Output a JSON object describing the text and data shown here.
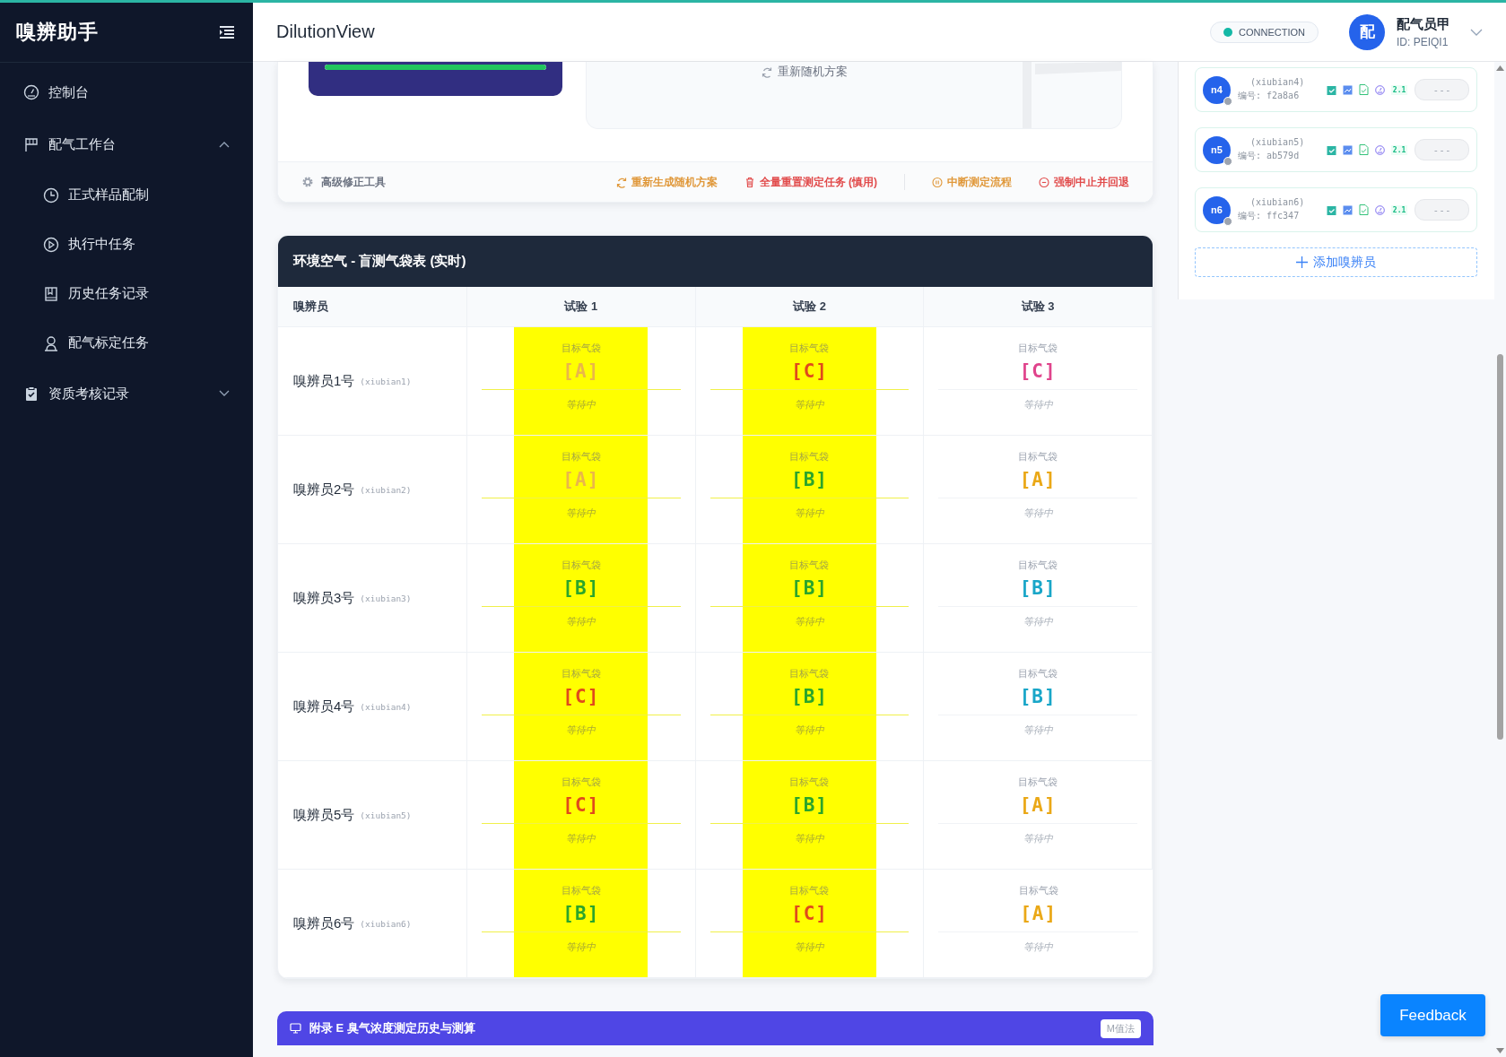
{
  "sidebar": {
    "logo": "嗅辨助手",
    "items": [
      {
        "label": "控制台"
      },
      {
        "label": "配气工作台",
        "expanded": true,
        "children": [
          {
            "label": "正式样品配制"
          },
          {
            "label": "执行中任务"
          },
          {
            "label": "历史任务记录"
          },
          {
            "label": "配气标定任务"
          }
        ]
      },
      {
        "label": "资质考核记录",
        "expanded": false
      }
    ]
  },
  "header": {
    "title": "DilutionView",
    "connection": "CONNECTION",
    "user": {
      "avatar": "配",
      "name": "配气员甲",
      "id": "ID: PEIQI1"
    }
  },
  "plan_card": {
    "progress": {
      "level": 1
    },
    "reshuffle": "重新随机方案",
    "footer": {
      "tool": "高级修正工具",
      "actions": [
        {
          "label": "重新生成随机方案",
          "color": "#e0983a"
        },
        {
          "label": "全量重置测定任务 (慎用)",
          "color": "#e14a4a"
        },
        {
          "label": "中断测定流程",
          "color": "#e0983a"
        },
        {
          "label": "强制中止并回退",
          "color": "#e14a4a"
        }
      ]
    }
  },
  "table": {
    "title": "环境空气 - 盲测气袋表 (实时)",
    "name_header": "嗅辨员",
    "columns": [
      {
        "label": "试验 1",
        "highlighted": true
      },
      {
        "label": "试验 2",
        "highlighted": true
      },
      {
        "label": "试验 3"
      }
    ],
    "rows": [
      {
        "name": "嗅辨员1号",
        "code": "(xiubian1)",
        "cells": [
          {
            "label": "目标气袋",
            "bag": "[A]",
            "color": "#eab64a",
            "status": "等待中"
          },
          {
            "label": "目标气袋",
            "bag": "[C]",
            "color": "#e04a1c",
            "status": "等待中"
          },
          {
            "label": "目标气袋",
            "bag": "[C]",
            "color": "#e0448c",
            "status": "等待中"
          }
        ]
      },
      {
        "name": "嗅辨员2号",
        "code": "(xiubian2)",
        "cells": [
          {
            "label": "目标气袋",
            "bag": "[A]",
            "color": "#eab64a",
            "status": "等待中"
          },
          {
            "label": "目标气袋",
            "bag": "[B]",
            "color": "#2ba52b",
            "status": "等待中"
          },
          {
            "label": "目标气袋",
            "bag": "[A]",
            "color": "#eaa817",
            "status": "等待中"
          }
        ]
      },
      {
        "name": "嗅辨员3号",
        "code": "(xiubian3)",
        "cells": [
          {
            "label": "目标气袋",
            "bag": "[B]",
            "color": "#2ba52b",
            "status": "等待中"
          },
          {
            "label": "目标气袋",
            "bag": "[B]",
            "color": "#2ba52b",
            "status": "等待中"
          },
          {
            "label": "目标气袋",
            "bag": "[B]",
            "color": "#19a6c8",
            "status": "等待中"
          }
        ]
      },
      {
        "name": "嗅辨员4号",
        "code": "(xiubian4)",
        "cells": [
          {
            "label": "目标气袋",
            "bag": "[C]",
            "color": "#e04a1c",
            "status": "等待中"
          },
          {
            "label": "目标气袋",
            "bag": "[B]",
            "color": "#2ba52b",
            "status": "等待中"
          },
          {
            "label": "目标气袋",
            "bag": "[B]",
            "color": "#19a6c8",
            "status": "等待中"
          }
        ]
      },
      {
        "name": "嗅辨员5号",
        "code": "(xiubian5)",
        "cells": [
          {
            "label": "目标气袋",
            "bag": "[C]",
            "color": "#e04a1c",
            "status": "等待中"
          },
          {
            "label": "目标气袋",
            "bag": "[B]",
            "color": "#2ba52b",
            "status": "等待中"
          },
          {
            "label": "目标气袋",
            "bag": "[A]",
            "color": "#eaa817",
            "status": "等待中"
          }
        ]
      },
      {
        "name": "嗅辨员6号",
        "code": "(xiubian6)",
        "cells": [
          {
            "label": "目标气袋",
            "bag": "[B]",
            "color": "#2ba52b",
            "status": "等待中"
          },
          {
            "label": "目标气袋",
            "bag": "[C]",
            "color": "#e04a1c",
            "status": "等待中"
          },
          {
            "label": "目标气袋",
            "bag": "[A]",
            "color": "#eaa817",
            "status": "等待中"
          }
        ]
      }
    ]
  },
  "appendix": {
    "title": "附录 E 臭气浓度测定历史与测算",
    "badge": "M值法"
  },
  "testers": [
    {
      "avatar": "n4",
      "code": "(xiubian4)",
      "serial": "编号: f2a8a6",
      "score": "2.1",
      "reading": "- - -"
    },
    {
      "avatar": "n5",
      "code": "(xiubian5)",
      "serial": "编号: ab579d",
      "score": "2.1",
      "reading": "- - -"
    },
    {
      "avatar": "n6",
      "code": "(xiubian6)",
      "serial": "编号: ffc347",
      "score": "2.1",
      "reading": "- - -"
    }
  ],
  "add_tester": "添加嗅辨员",
  "feedback": "Feedback"
}
